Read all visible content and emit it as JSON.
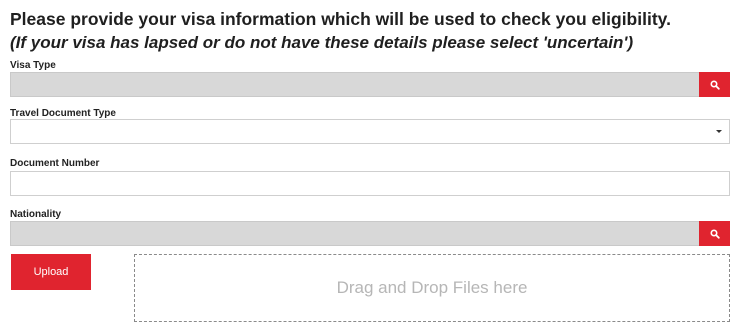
{
  "form": {
    "heading": "Please provide your visa information which will be used to check you eligibility.",
    "subheading": "(If your visa has lapsed or do not have these details please select 'uncertain')",
    "fields": {
      "visa_type": {
        "label": "Visa Type",
        "value": "",
        "button_icon": "search-icon"
      },
      "travel_document_type": {
        "label": "Travel Document Type",
        "value": "",
        "icon": "caret-down-icon"
      },
      "document_number": {
        "label": "Document Number",
        "value": ""
      },
      "nationality": {
        "label": "Nationality",
        "value": "",
        "button_icon": "search-icon"
      }
    },
    "upload_button_label": "Upload",
    "dropzone_text": "Drag and Drop Files here",
    "colors": {
      "accent": "#e0242f",
      "lookup_bg": "#d8d8d8",
      "text": "#1f1f1f"
    }
  }
}
